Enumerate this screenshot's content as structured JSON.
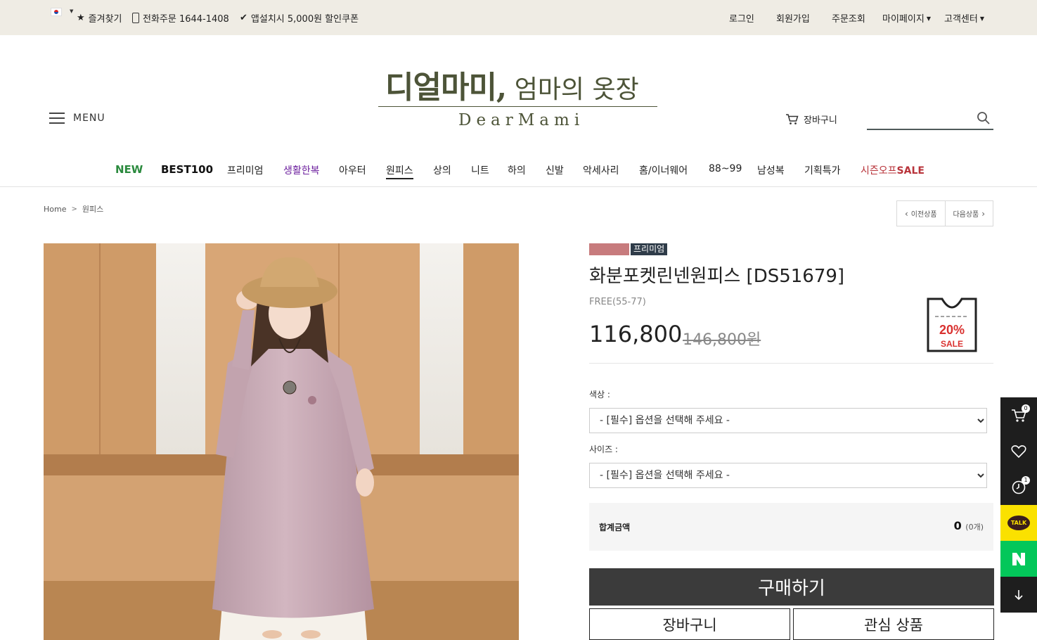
{
  "topbar": {
    "bookmark": "즐겨찾기",
    "phone_order": "전화주문 1644-1408",
    "app_coupon": "앱설치시 5,000원 할인쿠폰",
    "login": "로그인",
    "signup": "회원가입",
    "order_lookup": "주문조회",
    "mypage": "마이페이지",
    "customer_center": "고객센터"
  },
  "logo": {
    "kr_main": "디얼마미,",
    "kr_sub": " 엄마의 옷장",
    "en": "DearMami"
  },
  "header": {
    "menu_label": "MENU",
    "cart_label": "장바구니",
    "search_placeholder": ""
  },
  "nav": {
    "items": [
      "NEW",
      "BEST100",
      "프리미엄",
      "생활한복",
      "아우터",
      "원피스",
      "상의",
      "니트",
      "하의",
      "신발",
      "악세사리",
      "홈/이너웨어",
      "88~99",
      "남성복",
      "기획특가"
    ],
    "sale_prefix": "시즌오프",
    "sale_suffix": "SALE",
    "active": "원피스"
  },
  "breadcrumb": {
    "home": "Home",
    "current": "원피스"
  },
  "prevnext": {
    "prev": "이전상품",
    "next": "다음상품"
  },
  "product": {
    "badge": "프리미엄",
    "title": "화분포켓린넨원피스 [DS51679]",
    "size": "FREE(55-77)",
    "price": "116,800",
    "original_price": "146,800원",
    "sale_percent": "20%",
    "sale_label": "SALE"
  },
  "options": {
    "color_label": "색상 :",
    "size_label": "사이즈 :",
    "placeholder": "- [필수] 옵션을 선택해 주세요 -"
  },
  "total": {
    "label": "합계금액",
    "value": "0",
    "count": "(0개)"
  },
  "buttons": {
    "buy": "구매하기",
    "cart": "장바구니",
    "wishlist": "관심 상품"
  },
  "quickbar": {
    "cart_count": "0",
    "recent_count": "1",
    "talk": "TALK"
  },
  "colors": {
    "topbar_bg": "#efece4",
    "logo": "#4d5438",
    "buy_button": "#3b3b3b",
    "sale_red": "#d9312f",
    "badge_premium": "#2f3c49"
  }
}
